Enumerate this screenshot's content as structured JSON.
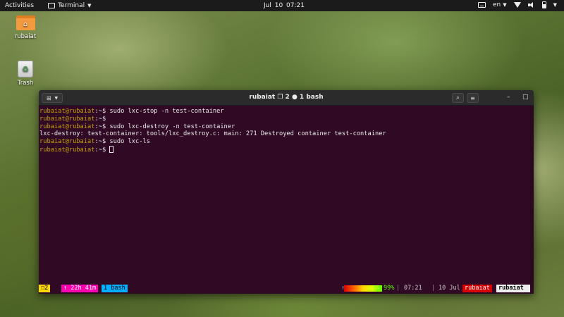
{
  "topbar": {
    "activities": "Activities",
    "app_menu": "Terminal",
    "clock": "Jul 10  07:21",
    "language": "en"
  },
  "desktop": {
    "icons": [
      {
        "label": "rubaiat",
        "icon": "home-folder-icon"
      },
      {
        "label": "Trash",
        "icon": "trash-icon"
      }
    ]
  },
  "terminal": {
    "title": "rubaiat ❐ 2 ● 1 bash",
    "lines": [
      {
        "user": "rubaiat@rubaiat",
        "path": ":~",
        "symbol": "$ ",
        "command": "sudo lxc-stop -n test-container"
      },
      {
        "user": "rubaiat@rubaiat",
        "path": ":~",
        "symbol": "$ ",
        "command": ""
      },
      {
        "user": "rubaiat@rubaiat",
        "path": ":~",
        "symbol": "$ ",
        "command": "sudo lxc-destroy -n test-container"
      },
      {
        "output": "lxc-destroy: test-container: tools/lxc_destroy.c: main: 271 Destroyed container test-container"
      },
      {
        "user": "rubaiat@rubaiat",
        "path": ":~",
        "symbol": "$ ",
        "command": "sudo lxc-ls"
      },
      {
        "user": "rubaiat@rubaiat",
        "path": ":~",
        "symbol": "$ ",
        "command": ""
      }
    ]
  },
  "status": {
    "session": "❐2",
    "uptime": "↑ 22h 41m",
    "window": "1 bash",
    "arrow": "↑",
    "battery": "99%",
    "time": "07:21",
    "date": "10 Jul",
    "user": "rubaiat",
    "host": "rubaiat",
    "sep": "|"
  },
  "colors": {
    "terminal_bg": "#300a24",
    "prompt_user": "#c4a000",
    "prompt_path": "#729fcf",
    "close_button": "#e95420"
  }
}
